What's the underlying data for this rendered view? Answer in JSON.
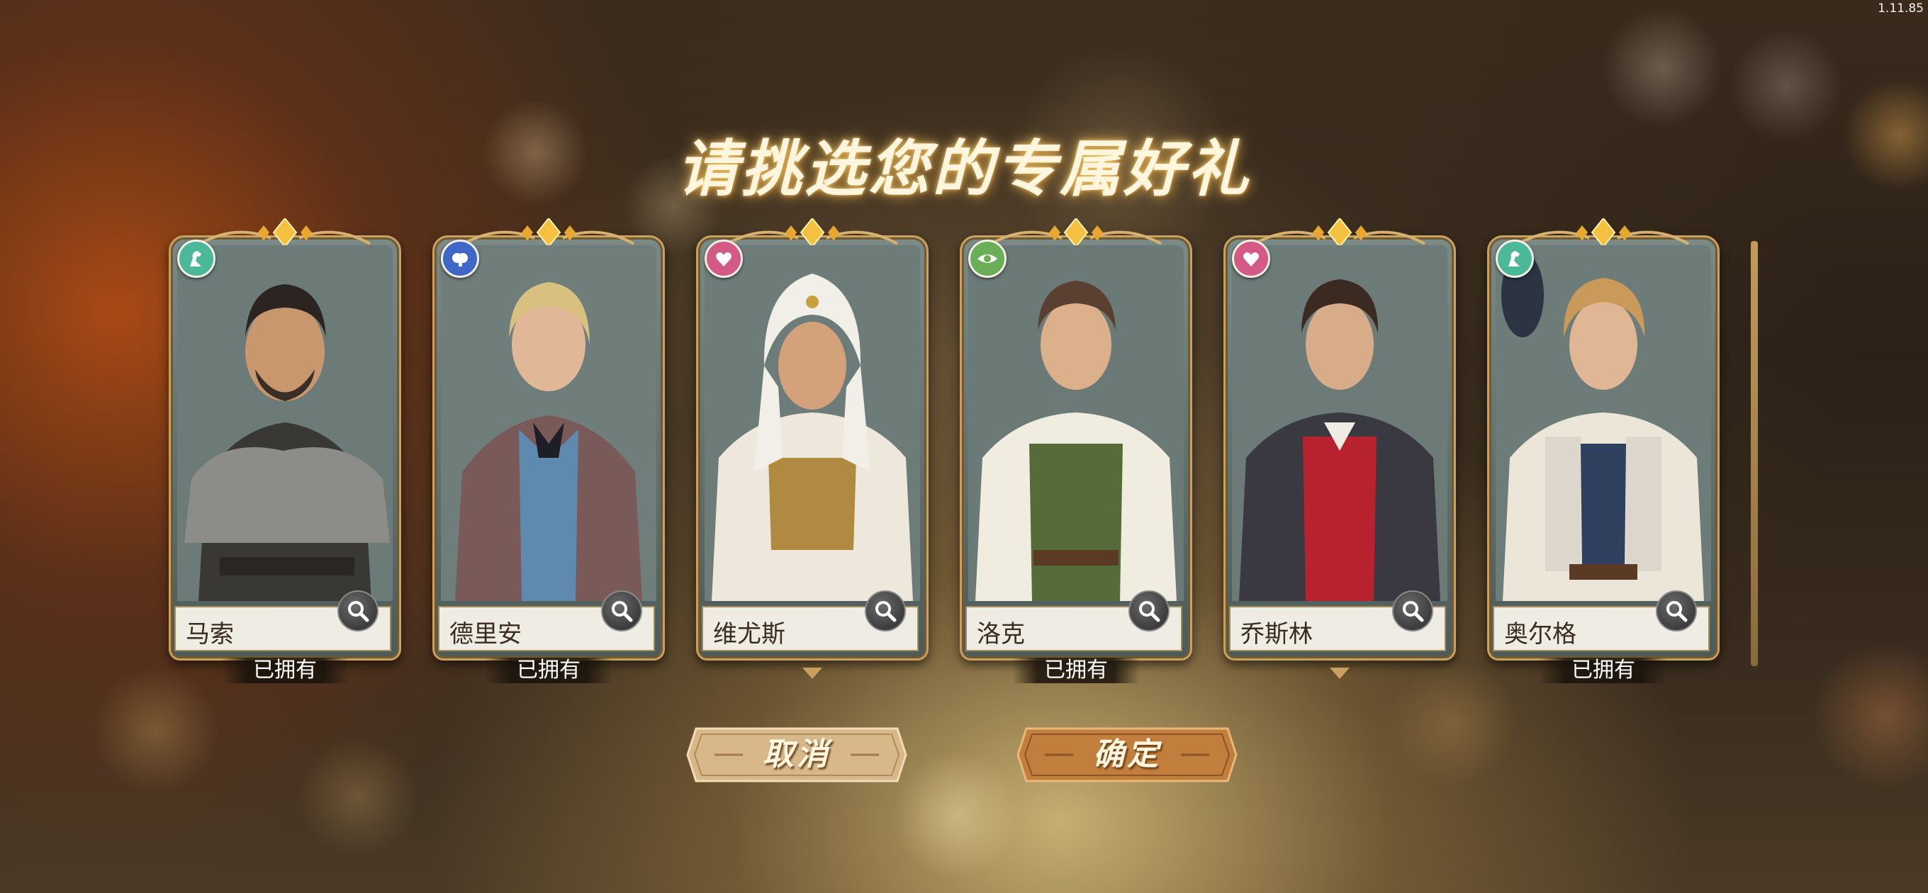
{
  "version": "1.11.85",
  "title": "请挑选您的专属好礼",
  "cards": [
    {
      "name": "马索",
      "status": "已拥有",
      "badge_icon": "horse-icon",
      "badge_color": "#4cb89a"
    },
    {
      "name": "德里安",
      "status": "已拥有",
      "badge_icon": "brain-icon",
      "badge_color": "#3f67c8"
    },
    {
      "name": "维尤斯",
      "status": "",
      "badge_icon": "heart-icon",
      "badge_color": "#d45a86"
    },
    {
      "name": "洛克",
      "status": "已拥有",
      "badge_icon": "eye-icon",
      "badge_color": "#6aae58"
    },
    {
      "name": "乔斯林",
      "status": "",
      "badge_icon": "heart-icon",
      "badge_color": "#d45a86"
    },
    {
      "name": "奥尔格",
      "status": "已拥有",
      "badge_icon": "horse-icon",
      "badge_color": "#4cb89a"
    }
  ],
  "buttons": {
    "cancel_label": "取消",
    "confirm_label": "确定"
  },
  "colors": {
    "gold": "#c9a060",
    "button_cancel": "#d8b88a",
    "button_confirm": "#c27e3c"
  }
}
